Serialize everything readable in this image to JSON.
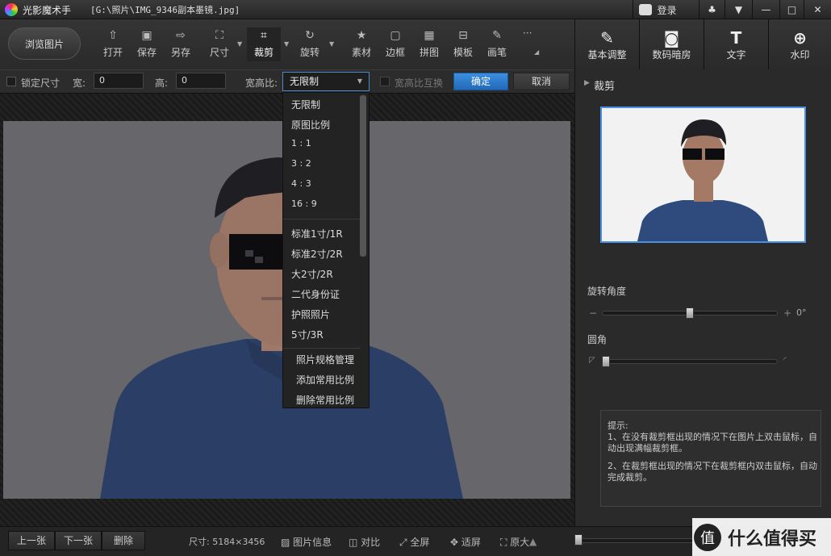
{
  "app": {
    "name": "光影魔术手",
    "file": "[G:\\照片\\IMG_9346副本墨镜.jpg]"
  },
  "titlebar": {
    "login": "登录",
    "icons": [
      "user-icon",
      "skin-icon",
      "menu-icon",
      "minimize-icon",
      "maximize-icon",
      "close-icon"
    ]
  },
  "toolbar": {
    "browse": "浏览图片",
    "tools": [
      "打开",
      "保存",
      "另存",
      "尺寸",
      "裁剪",
      "旋转",
      "素材",
      "边框",
      "拼图",
      "模板",
      "画笔"
    ],
    "more": "···"
  },
  "right_tools": [
    "基本调整",
    "数码暗房",
    "文字",
    "水印"
  ],
  "options": {
    "lock_size": "锁定尺寸",
    "width_label": "宽:",
    "width_value": "0",
    "height_label": "高:",
    "height_value": "0",
    "ratio_label": "宽高比:",
    "ratio_value": "无限制",
    "swap": "宽高比互换",
    "confirm": "确定",
    "cancel": "取消"
  },
  "dropdown": {
    "group1": [
      "无限制",
      "原图比例",
      "1 : 1",
      "3 : 2",
      "4 : 3",
      "16 : 9"
    ],
    "group2": [
      "标准1寸/1R",
      "标准2寸/2R",
      "大2寸/2R",
      "二代身份证",
      "护照照片",
      "5寸/3R"
    ],
    "group3": [
      "照片规格管理",
      "添加常用比例",
      "删除常用比例"
    ]
  },
  "panel": {
    "section": "裁剪",
    "rotate_label": "旋转角度",
    "rotate_value": "0°",
    "rotate_minus": "−",
    "rotate_plus": "+",
    "corner_label": "圆角"
  },
  "tips": {
    "title": "提示:",
    "line1": "1、在没有裁剪框出现的情况下在图片上双击鼠标，自动出现满幅裁剪框。",
    "line2": "2、在裁剪框出现的情况下在裁剪框内双击鼠标，自动完成裁剪。"
  },
  "status": {
    "prev": "上一张",
    "next": "下一张",
    "delete": "删除",
    "size": "尺寸: 5184×3456",
    "info": "图片信息",
    "compare": "对比",
    "fullscreen": "全屏",
    "fit": "适屏",
    "original": "原大"
  },
  "watermark": {
    "brand": "什么值得买",
    "mark": "值"
  },
  "colors": {
    "accent": "#2e7bd0",
    "selection": "#4a90e2",
    "bg": "#2a2a2a",
    "shirt": "#2f4a7d"
  }
}
